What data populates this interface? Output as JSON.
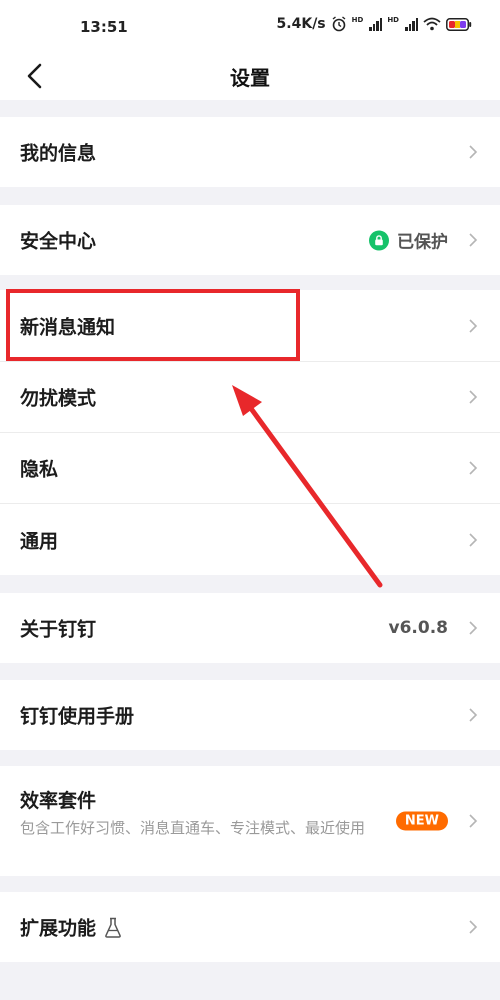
{
  "status": {
    "time": "13:51",
    "speed": "5.4K/s",
    "hd1": "HD",
    "hd2": "HD"
  },
  "nav": {
    "title": "设置"
  },
  "items": {
    "my_info": "我的信息",
    "security": "安全中心",
    "security_status": "已保护",
    "notifications": "新消息通知",
    "dnd": "勿扰模式",
    "privacy": "隐私",
    "general": "通用",
    "about": "关于钉钉",
    "version": "v6.0.8",
    "manual": "钉钉使用手册",
    "efficiency": "效率套件",
    "efficiency_sub": "包含工作好习惯、消息直通车、专注模式、最近使用",
    "efficiency_badge": "NEW",
    "extensions": "扩展功能"
  },
  "colors": {
    "highlight": "#e8282b",
    "secure_green": "#16c26a",
    "badge_orange": "#ff6b00"
  }
}
